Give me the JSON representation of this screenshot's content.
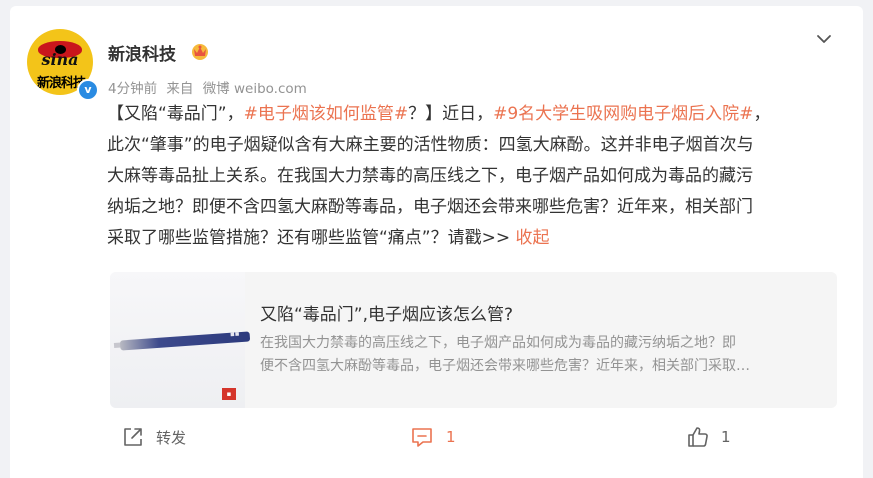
{
  "post": {
    "author": {
      "name": "新浪科技",
      "avatar_text_top": "sina",
      "avatar_text_bottom": "新浪科技",
      "verified_icon": "verified-badge-icon",
      "badge_icon": "crown-icon"
    },
    "meta": {
      "time": "4分钟前",
      "source_prefix": "来自",
      "source": "微博 weibo.com"
    },
    "content": {
      "seg1": "【又陷“毒品门”，",
      "tag1": "#电子烟该如何监管#",
      "seg2": "？】近日，",
      "tag2": "#9名大学生吸网购电子烟后入院#",
      "seg3": "，",
      "line2": "此次“肇事”的电子烟疑似含有大麻主要的活性物质：四氢大麻酚。这并非电子烟首次与",
      "line3": "大麻等毒品扯上关系。在我国大力禁毒的高压线之下，电子烟产品如何成为毒品的藏污",
      "line4": "纳垢之地？即便不含四氢大麻酚等毒品，电子烟还会带来哪些危害？近年来，相关部门",
      "line5": "采取了哪些监管措施？还有哪些监管“痛点”？请戳>> ",
      "collapse": "收起"
    },
    "share_card": {
      "title": "又陷“毒品门”,电子烟应该怎么管?",
      "desc_line1": "在我国大力禁毒的高压线之下，电子烟产品如何成为毒品的藏污纳垢之地？即",
      "desc_line2": "便不含四氢大麻酚等毒品，电子烟还会带来哪些危害？近年来，相关部门采取…"
    },
    "actions": {
      "repost_label": "转发",
      "comment_count": "1",
      "like_count": "1"
    }
  },
  "colors": {
    "accent": "#eb7350",
    "text": "#333333",
    "muted": "#939393",
    "verified": "#2a8be2"
  }
}
